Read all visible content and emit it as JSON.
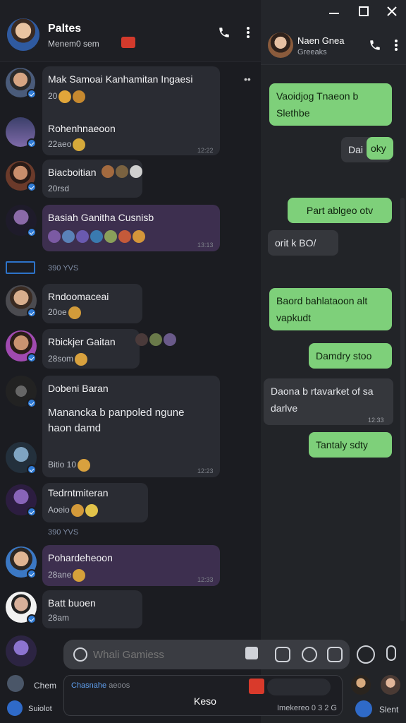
{
  "window": {
    "minimize_icon": "minimize-icon",
    "maximize_icon": "maximize-icon",
    "close_icon": "close-icon"
  },
  "left_header": {
    "title": "Paltes",
    "subtitle": "Menem0 sem",
    "phone_icon": "phone-icon",
    "menu_icon": "more-vertical-icon"
  },
  "chats": [
    {
      "name": "Mak Samoai Kanhamitan Ingaesi",
      "meta": "20",
      "time": ""
    },
    {
      "name": "Rohenhnaeoon",
      "meta": "22aeo",
      "time": "12:22"
    },
    {
      "name": "Biacboitian",
      "meta": "20rsd",
      "time": ""
    },
    {
      "name": "Basiah Ganitha Cusnisb",
      "meta": "",
      "time": "13:13"
    },
    {
      "name": "Rndoomaceai",
      "meta": "20oe",
      "time": ""
    },
    {
      "name": "Rbickjer Gaitan",
      "meta": "28som",
      "time": ""
    },
    {
      "name": "Dobeni Baran",
      "message": "Manancka b panpoled ngune haon damd",
      "meta": "Bitio 10",
      "time": "12:23"
    },
    {
      "name": "Tedrntmiteran",
      "meta": "Aoeio",
      "time": ""
    },
    {
      "name": "Pohardeheoon",
      "meta": "28ane",
      "time": "12:33"
    },
    {
      "name": "Batt buoen",
      "meta": "28am",
      "time": ""
    }
  ],
  "separators": [
    "390 YVS",
    "390 YVS"
  ],
  "right_header": {
    "name": "Naen Gnea",
    "status": "Greeaks",
    "phone_icon": "phone-icon",
    "menu_icon": "more-vertical-icon"
  },
  "messages": [
    {
      "side": "sent",
      "text": "Vaoidjog Tnaeon b Slethbe"
    },
    {
      "side": "recv",
      "text": "Dai"
    },
    {
      "side": "sent",
      "text": "oky"
    },
    {
      "side": "sent",
      "text": "Part ablgeo otv"
    },
    {
      "side": "recv",
      "text": "orit k BO/"
    },
    {
      "side": "sent",
      "text": "Baord bahlataoon alt vapkudt"
    },
    {
      "side": "sent",
      "text": "Damdry stoo"
    },
    {
      "side": "recv",
      "text": "Daona b rtavarket of sa darlve",
      "time": "12:33"
    },
    {
      "side": "sent",
      "text": "Tantaly sdty"
    }
  ],
  "composer": {
    "placeholder": "Whali Gamiess",
    "value": "",
    "items": [
      "Chem",
      "Suiolot"
    ]
  },
  "bottom_card": {
    "label": "Chasnahe",
    "sublabel": "aeoos",
    "center": "Keso",
    "right": "Imekereo 0 3 2 G",
    "right_profile": "Slent"
  },
  "colors": {
    "sent_bubble": "#7ed07a",
    "received_bubble": "#35373c",
    "purple_bubble": "#3d2f4f",
    "accent": "#2f7bd6"
  }
}
